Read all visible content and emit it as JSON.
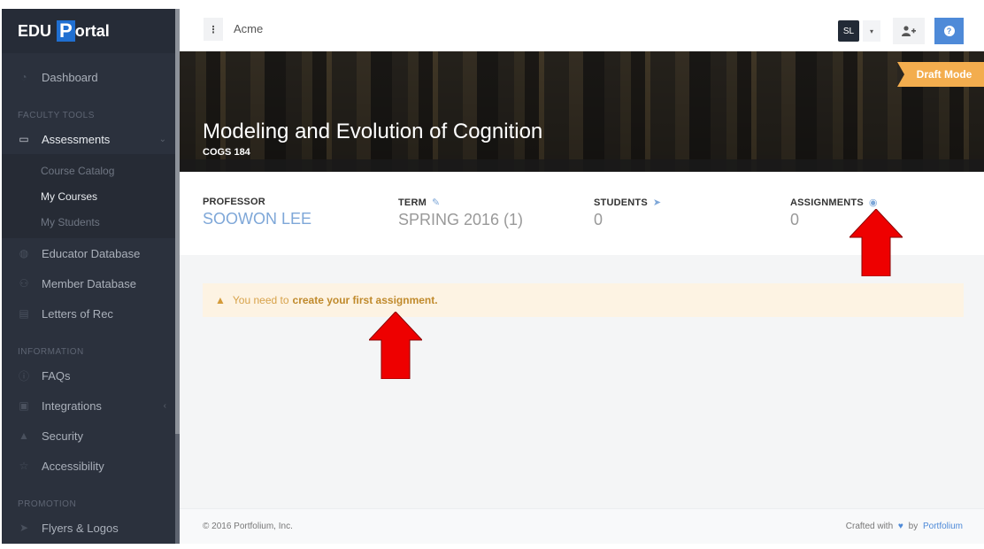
{
  "brand": {
    "prefix": "EDU",
    "highlight": "P",
    "suffix": "ortal"
  },
  "sidebar": {
    "dashboard": {
      "label": "Dashboard",
      "icon": "dashboard-icon"
    },
    "sections": [
      {
        "label": "FACULTY TOOLS"
      },
      {
        "label": "INFORMATION"
      },
      {
        "label": "PROMOTION"
      }
    ],
    "assessments": {
      "label": "Assessments",
      "icon": "folder-icon",
      "expanded": true,
      "children": [
        {
          "label": "Course Catalog",
          "active": false
        },
        {
          "label": "My Courses",
          "active": true
        },
        {
          "label": "My Students",
          "active": false
        }
      ]
    },
    "faculty_items": [
      {
        "label": "Educator Database",
        "icon": "globe-icon"
      },
      {
        "label": "Member Database",
        "icon": "users-icon"
      },
      {
        "label": "Letters of Rec",
        "icon": "document-icon"
      }
    ],
    "info_items": [
      {
        "label": "FAQs",
        "icon": "info-icon"
      },
      {
        "label": "Integrations",
        "icon": "puzzle-icon"
      },
      {
        "label": "Security",
        "icon": "lock-icon"
      },
      {
        "label": "Accessibility",
        "icon": "star-icon"
      }
    ],
    "promo_items": [
      {
        "label": "Flyers & Logos",
        "icon": "send-icon"
      }
    ]
  },
  "topbar": {
    "menu_icon": "⋮",
    "org_name": "Acme",
    "user_initials": "SL",
    "caret": "▾",
    "add_user_icon": "👤+",
    "help_icon": "?"
  },
  "hero": {
    "title": "Modeling and Evolution of Cognition",
    "code": "COGS 184",
    "badge": "Draft Mode"
  },
  "stats": [
    {
      "label": "PROFESSOR",
      "value": "SOOWON LEE",
      "icon": ""
    },
    {
      "label": "TERM",
      "value": "SPRING 2016 (1)",
      "icon": "✎"
    },
    {
      "label": "STUDENTS",
      "value": "0",
      "icon": "➤"
    },
    {
      "label": "ASSIGNMENTS",
      "value": "0",
      "icon": "◉"
    }
  ],
  "alert": {
    "icon": "▲",
    "text": "You need to",
    "link": "create your first assignment."
  },
  "footer": {
    "copyright": "© 2016 Portfolium, Inc.",
    "crafted_prefix": "Crafted with",
    "heart": "♥",
    "crafted_by": "by",
    "brand_link": "Portfolium"
  },
  "annotations": {
    "color": "#ee0000"
  }
}
